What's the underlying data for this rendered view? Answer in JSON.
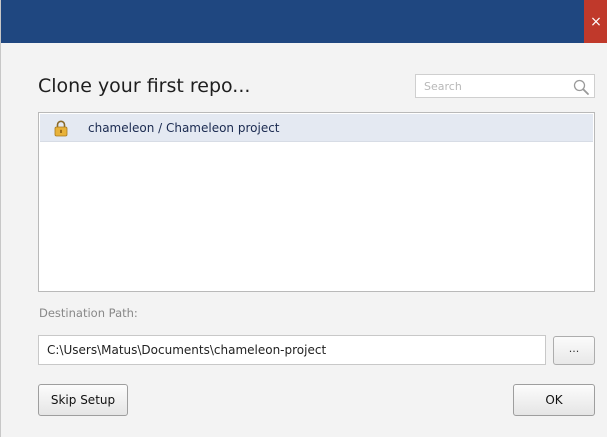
{
  "window": {
    "close_glyph": "×"
  },
  "header": {
    "title": "Clone your first repo..."
  },
  "search": {
    "placeholder": "Search",
    "value": ""
  },
  "repos": [
    {
      "label": "chameleon / Chameleon project",
      "icon": "lock-icon",
      "selected": true
    }
  ],
  "destination": {
    "label": "Destination Path:",
    "value": "C:\\Users\\Matus\\Documents\\chameleon-project",
    "browse_label": "..."
  },
  "buttons": {
    "skip": "Skip Setup",
    "ok": "OK"
  },
  "colors": {
    "titlebar": "#1f4780",
    "close": "#c0392b",
    "selected_row": "#e4e9f2"
  }
}
